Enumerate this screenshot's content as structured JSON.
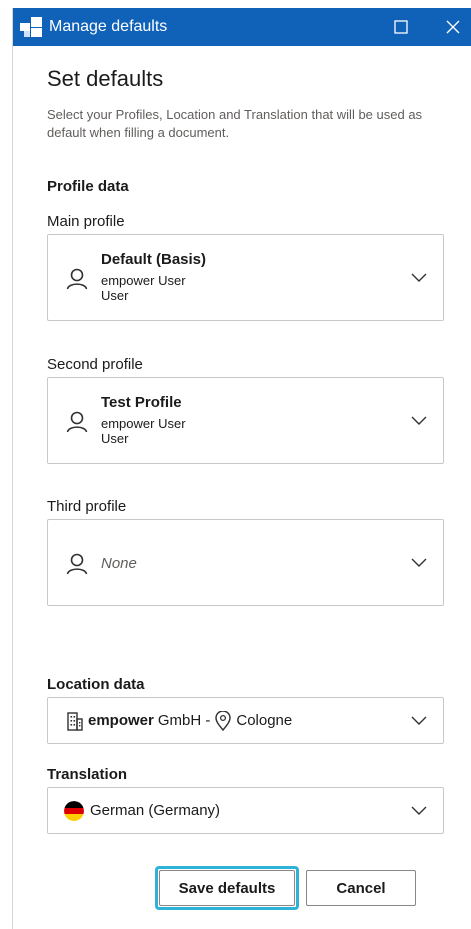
{
  "window": {
    "title": "Manage defaults",
    "titlebar_color": "#0f62b8",
    "icons": {
      "app": "app-logo-icon",
      "maximize": "maximize-icon",
      "close": "close-icon"
    }
  },
  "main": {
    "heading": "Set defaults",
    "description": "Select your Profiles, Location and Translation that will be used as default when filling a document."
  },
  "profile_data": {
    "section_label": "Profile data",
    "main_profile": {
      "label": "Main profile",
      "name": "Default (Basis)",
      "line1": "empower User",
      "line2": "User"
    },
    "second_profile": {
      "label": "Second profile",
      "name": "Test Profile",
      "line1": "empower User",
      "line2": "User"
    },
    "third_profile": {
      "label": "Third profile",
      "value": "None"
    }
  },
  "location_data": {
    "section_label": "Location data",
    "company_bold": "empower",
    "company_rest": "GmbH -",
    "city": "Cologne",
    "icons": {
      "company": "building-icon",
      "city": "location-pin-icon"
    }
  },
  "translation": {
    "label": "Translation",
    "value": "German (Germany)",
    "icon": "germany-flag-icon"
  },
  "buttons": {
    "save": "Save defaults",
    "cancel": "Cancel",
    "focus_color": "#2fb1d8"
  }
}
